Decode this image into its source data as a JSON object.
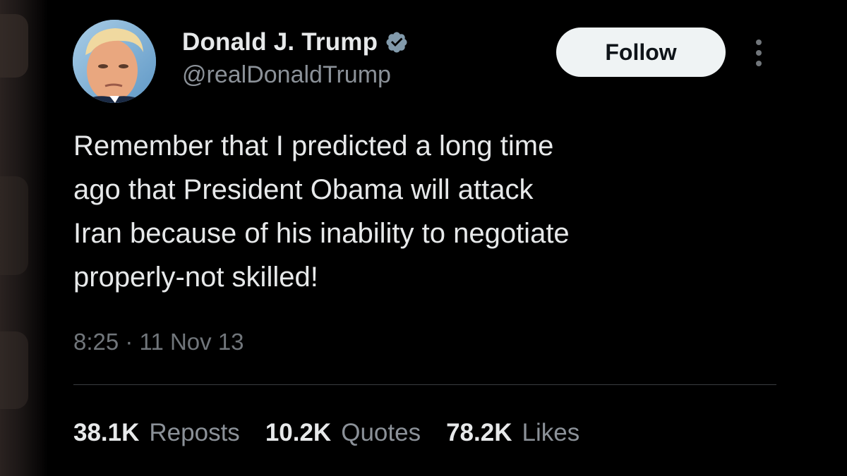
{
  "tweet": {
    "author": {
      "display_name": "Donald J. Trump",
      "handle": "@realDonaldTrump",
      "verified_icon": "verified-badge-icon",
      "avatar_icon": "profile-photo"
    },
    "follow_label": "Follow",
    "more_icon": "more-options-icon",
    "text_lines": [
      "Remember that I predicted a long time",
      "ago that President Obama will attack",
      "Iran because of his inability to negotiate",
      "properly-not skilled!"
    ],
    "timestamp": "8:25 · 11 Nov 13",
    "stats": {
      "reposts_count": "38.1K",
      "reposts_label": "Reposts",
      "quotes_count": "10.2K",
      "quotes_label": "Quotes",
      "likes_count": "78.2K",
      "likes_label": "Likes"
    }
  },
  "colors": {
    "background": "#000000",
    "primary_text": "#e7e9ea",
    "secondary_text": "#71767b",
    "follow_button_bg": "#eff3f4",
    "verified_badge": "#829aab"
  }
}
